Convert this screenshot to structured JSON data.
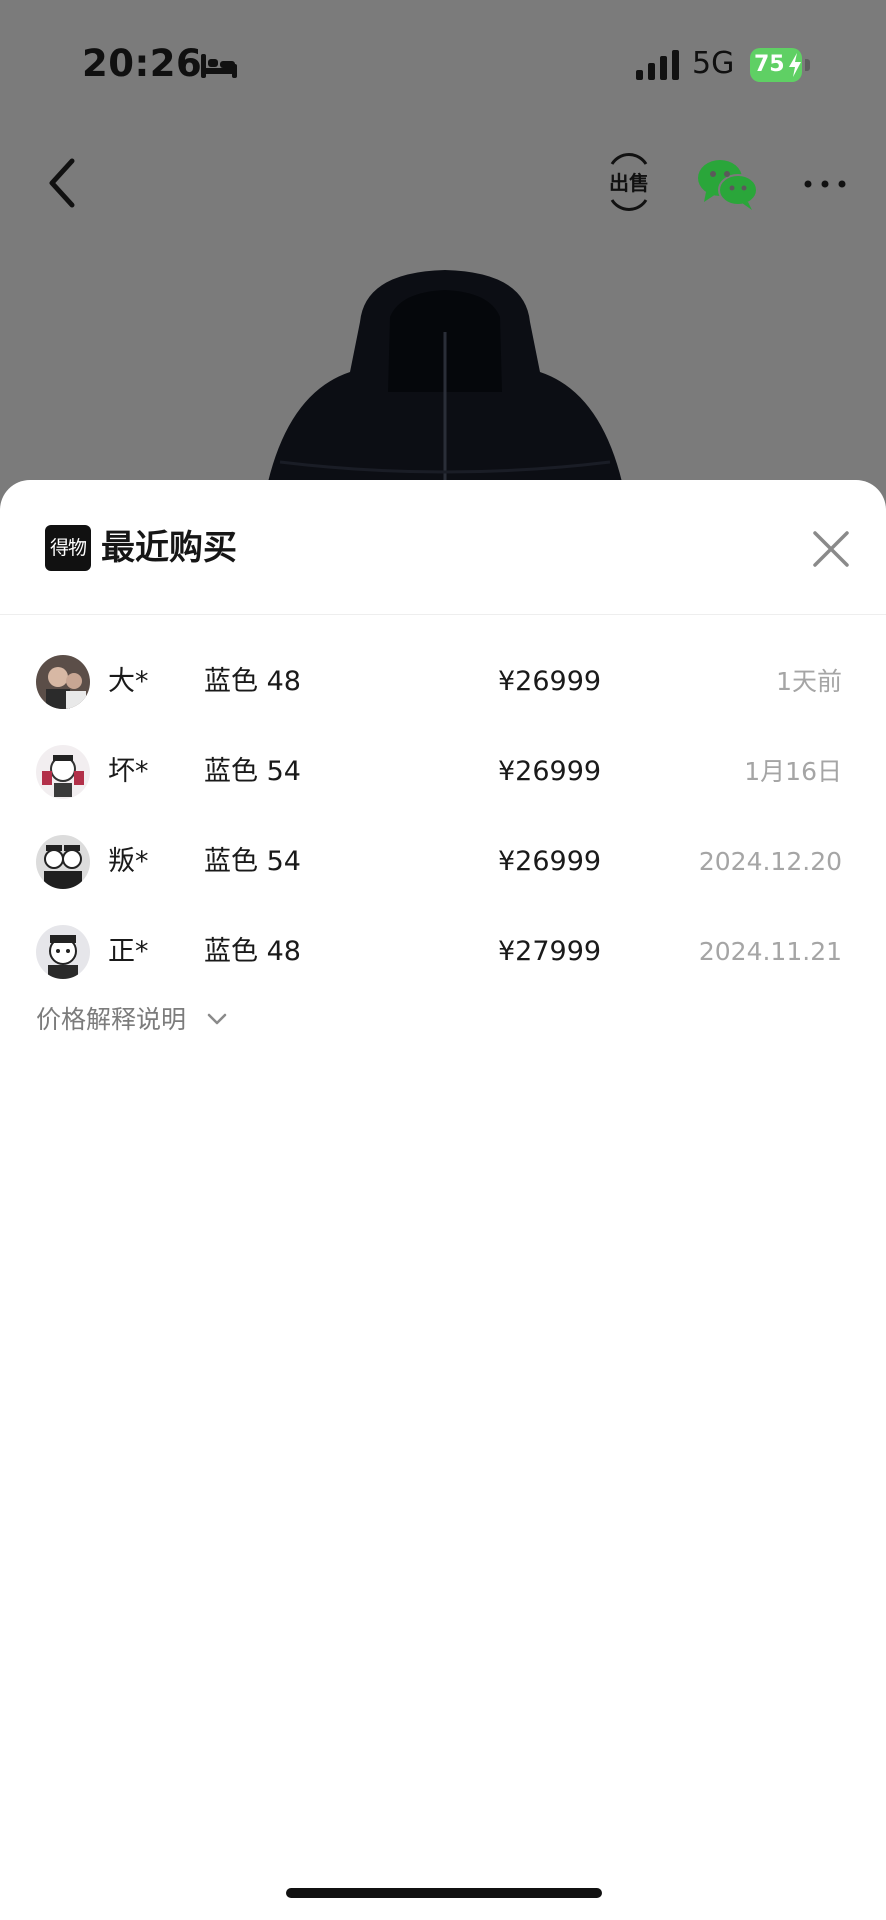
{
  "status_bar": {
    "time": "20:26",
    "network": "5G",
    "battery": "75"
  },
  "nav": {
    "sell_icon": "sell-tag-icon",
    "share_icon": "wechat-icon",
    "more_icon": "more-dots-icon"
  },
  "sheet": {
    "logo_text": "得物",
    "title": "最近购买",
    "close_icon": "close-icon",
    "footer_link": "价格解释说明"
  },
  "purchases": [
    {
      "name": "大*",
      "variant": "蓝色 48",
      "price": "¥26999",
      "date": "1天前"
    },
    {
      "name": "坏*",
      "variant": "蓝色 54",
      "price": "¥26999",
      "date": "1月16日"
    },
    {
      "name": "叛*",
      "variant": "蓝色 54",
      "price": "¥26999",
      "date": "2024.12.20"
    },
    {
      "name": "正*",
      "variant": "蓝色 48",
      "price": "¥27999",
      "date": "2024.11.21"
    }
  ],
  "colors": {
    "backdrop": "#7b7b7b",
    "battery": "#5fd064",
    "wechat": "#2aa63a",
    "muted_text": "#a5a5a5"
  }
}
